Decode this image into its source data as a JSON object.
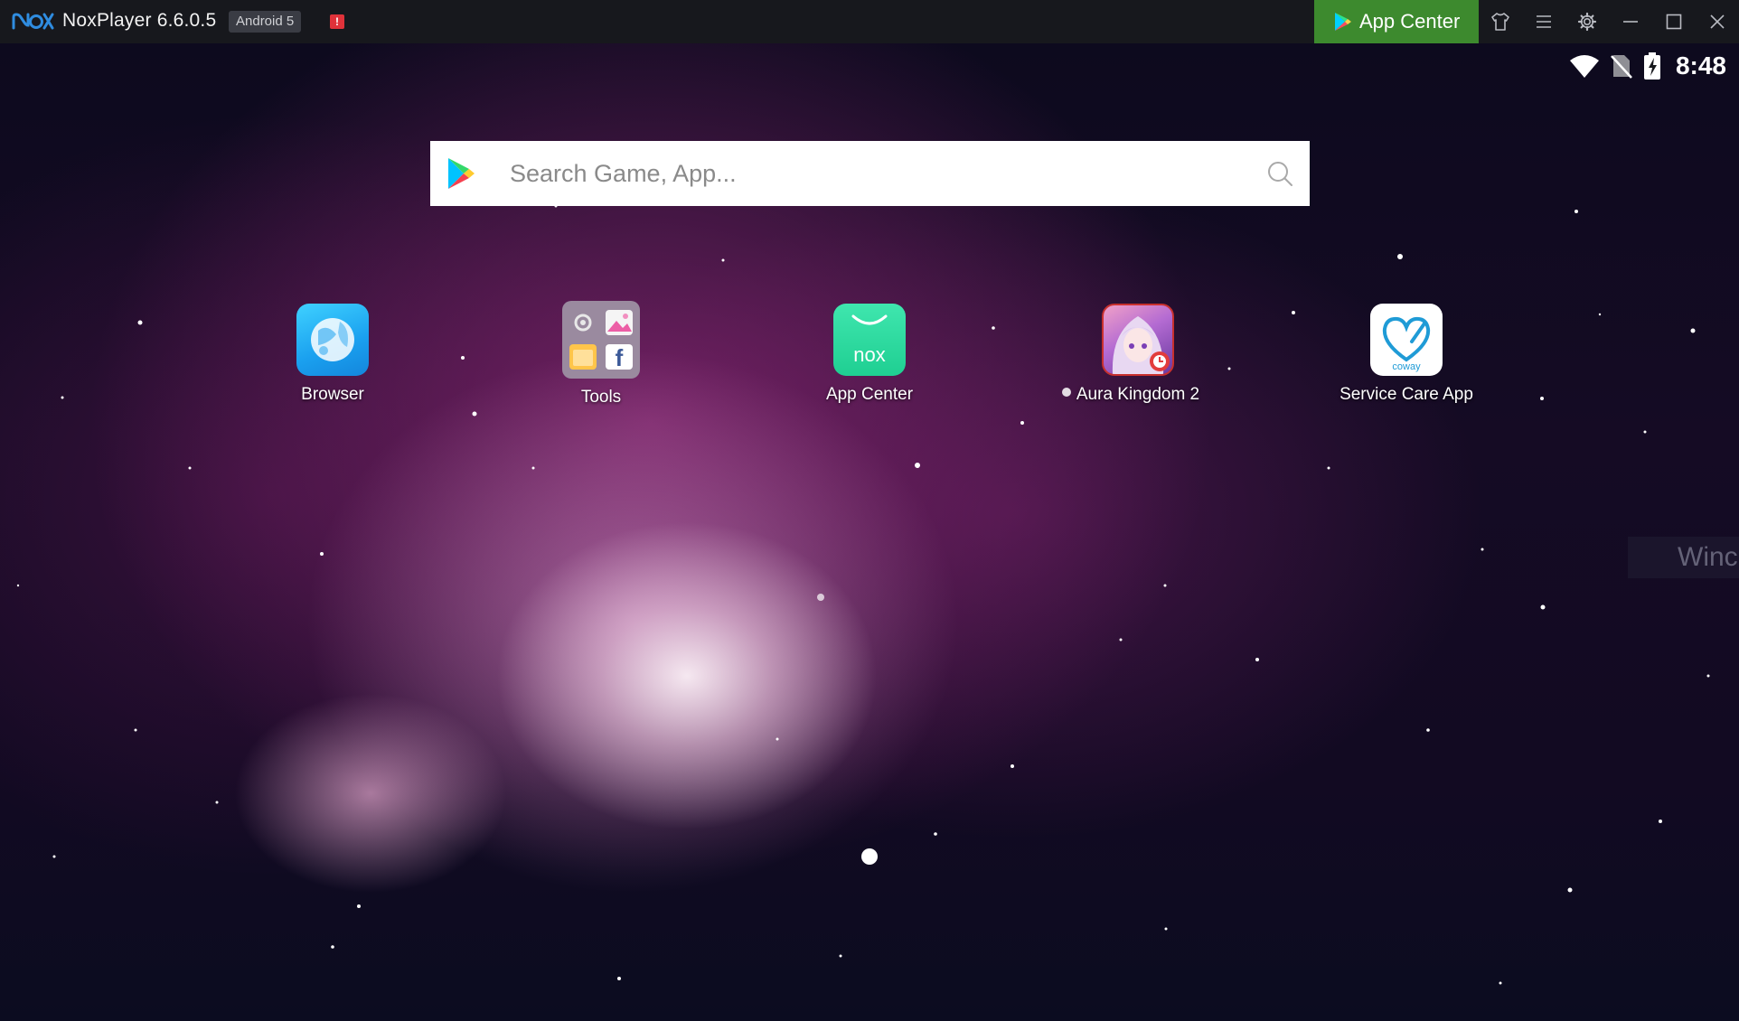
{
  "titlebar": {
    "logo": "nox-logo",
    "title": "NoxPlayer 6.6.0.5",
    "android_badge": "Android 5",
    "alert_glyph": "!",
    "app_center_label": "App Center",
    "buttons": [
      "shirt-icon",
      "menu-icon",
      "gear-icon",
      "minimize-icon",
      "maximize-icon",
      "close-icon"
    ],
    "accent_color": "#3d8a2e"
  },
  "status_bar": {
    "time": "8:48",
    "icons": [
      "wifi-icon",
      "no-sim-icon",
      "battery-charging-icon"
    ]
  },
  "search": {
    "placeholder": "Search Game, App..."
  },
  "apps": [
    {
      "label": "Browser",
      "icon": "browser-icon"
    },
    {
      "label": "Tools",
      "icon": "tools-folder-icon"
    },
    {
      "label": "App Center",
      "icon": "app-center-icon"
    },
    {
      "label": "Aura Kingdom 2",
      "icon": "aura-kingdom-icon"
    },
    {
      "label": "Service Care App",
      "icon": "coway-icon"
    }
  ],
  "tools_folder": {
    "facebook_glyph": "f"
  },
  "app_center_icon_text": "nox",
  "coway_text": "coway",
  "windows_overlay": "Winc",
  "page_indicator": {
    "current": 1,
    "total": 1
  }
}
